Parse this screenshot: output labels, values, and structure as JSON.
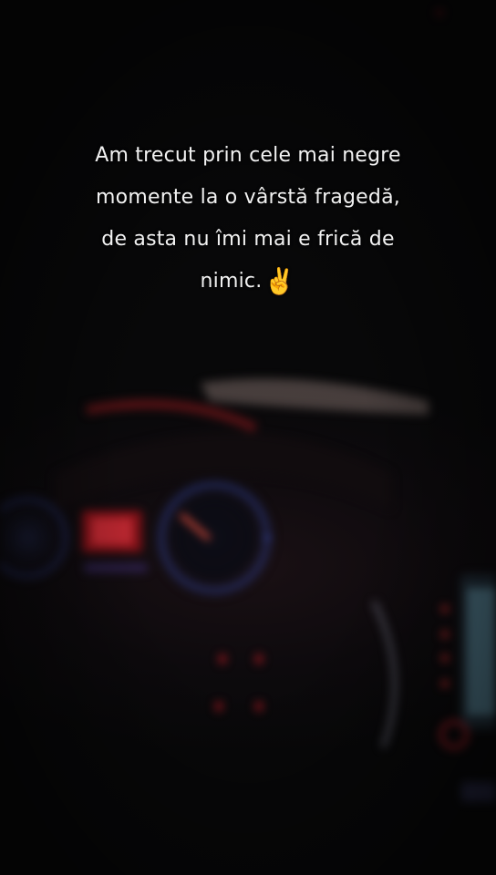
{
  "caption": {
    "line1": "Am trecut prin cele mai negre",
    "line2": "momente la o vârstă fragedă,",
    "line3": "de asta nu îmi mai e frică de",
    "line4": "nimic.",
    "emoji": "✌️"
  },
  "photo": {
    "subject": "car-dashboard-at-night",
    "accent_blue": "#3a4fb8",
    "accent_red": "#c0202a"
  }
}
